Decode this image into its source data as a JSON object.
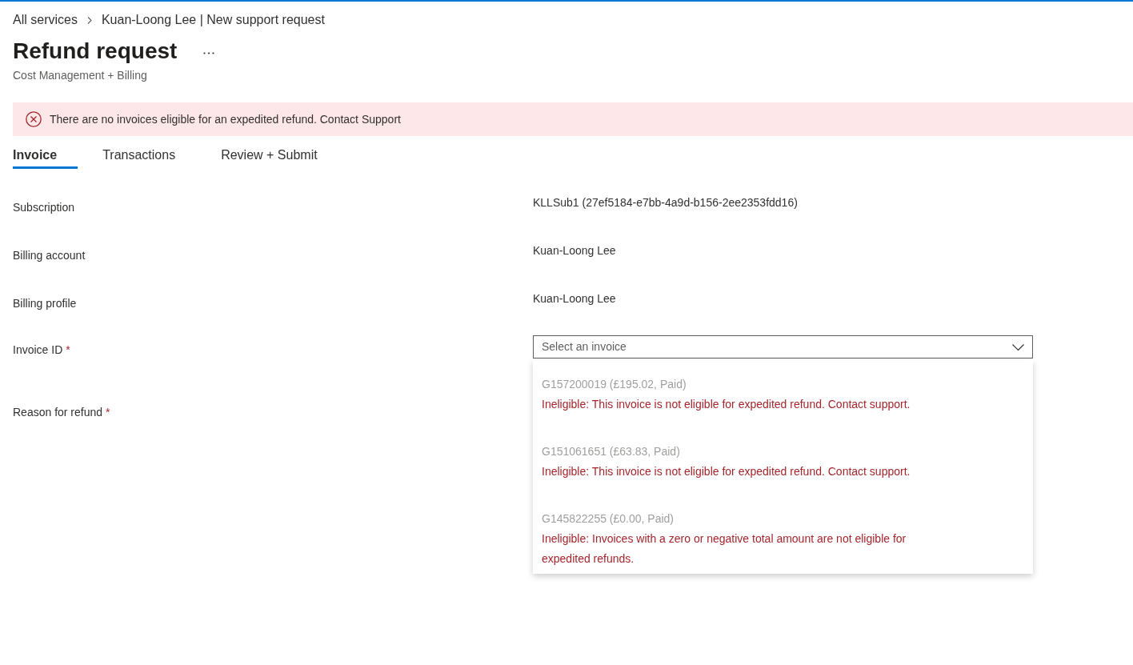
{
  "breadcrumb": [
    {
      "label": "All services"
    },
    {
      "label": "Kuan-Loong Lee | New support request"
    }
  ],
  "header": {
    "title": "Refund request",
    "subtitle": "Cost Management + Billing"
  },
  "alert": {
    "kind": "error",
    "message": "There are no invoices eligible for an expedited refund. Contact Support"
  },
  "tabs": [
    {
      "label": "Invoice",
      "selected": true
    },
    {
      "label": "Transactions",
      "selected": false
    },
    {
      "label": "Review + Submit",
      "selected": false
    }
  ],
  "form": {
    "fields": [
      {
        "label": "Subscription",
        "kind": "text",
        "value": "KLLSub1 (27ef5184-e7bb-4a9d-b156-2ee2353fdd16)"
      },
      {
        "label": "Billing account",
        "kind": "text",
        "value": "Kuan-Loong Lee"
      },
      {
        "label": "Billing profile",
        "kind": "text",
        "value": "Kuan-Loong Lee"
      },
      {
        "label": "Invoice ID",
        "required_mark": "*",
        "kind": "dropdown",
        "placeholder": "Select an invoice",
        "expanded": true,
        "options": [
          {
            "label": "G157200019 (£195.02, Paid)",
            "disabled": true,
            "note": "Ineligible: This invoice is not eligible for expedited refund. Contact support."
          },
          {
            "label": "G151061651 (£63.83, Paid)",
            "disabled": true,
            "note": "Ineligible: This invoice is not eligible for expedited refund. Contact support."
          },
          {
            "label": "G145822255 (£0.00, Paid)",
            "disabled": true,
            "note": "Ineligible: Invoices with a zero or negative total amount are not eligible for expedited refunds."
          }
        ]
      },
      {
        "label": "Reason for refund",
        "required_mark": "*",
        "kind": "covered"
      }
    ]
  }
}
